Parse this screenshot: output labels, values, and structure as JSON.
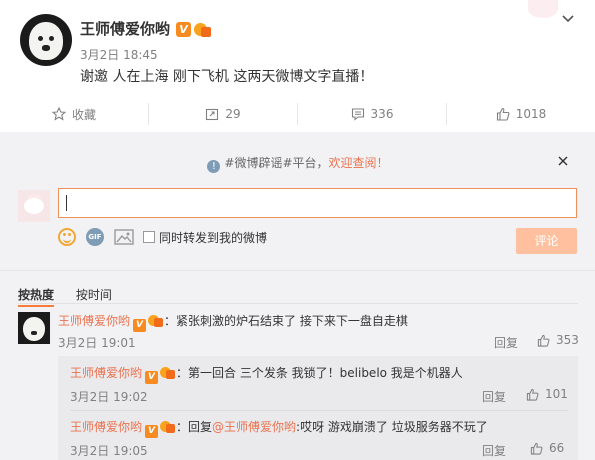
{
  "post": {
    "author": "王师傅爱你哟",
    "verified_badge": "V",
    "time": "3月2日 18:45",
    "text": "谢邀 人在上海 刚下飞机 这两天微博文字直播！",
    "actions": [
      {
        "label": "收藏",
        "icon": "star-icon"
      },
      {
        "label": "29",
        "icon": "share-icon"
      },
      {
        "label": "336",
        "icon": "comment-icon"
      },
      {
        "label": "1018",
        "icon": "like-icon"
      }
    ]
  },
  "notice": {
    "prefix": "#微博辟谣#平台，",
    "link": "欢迎查阅！"
  },
  "composer": {
    "input_value": "",
    "repost_label": "同时转发到我的微博",
    "submit_label": "评论"
  },
  "sort": {
    "hot": "按热度",
    "time": "按时间"
  },
  "comments": [
    {
      "name": "王师傅爱你哟",
      "badge": "V",
      "text": "：紧张刺激的炉石结束了 接下来下一盘自走棋",
      "time": "3月2日 19:01",
      "reply": "回复",
      "likes": "353"
    }
  ],
  "replies": [
    {
      "name": "王师傅爱你哟",
      "badge": "V",
      "text": "：第一回合 三个发条 我锁了！belibelo 我是个机器人",
      "time": "3月2日 19:02",
      "reply": "回复",
      "likes": "101"
    },
    {
      "name": "王师傅爱你哟",
      "badge": "V",
      "text_prefix": "：回复",
      "mention": "@王师傅爱你哟",
      "text": ":哎呀 游戏崩溃了 垃圾服务器不玩了",
      "time": "3月2日 19:05",
      "reply": "回复",
      "likes": "66"
    }
  ],
  "colors": {
    "accent": "#eb7350",
    "badge": "#f78b1f",
    "submit_disabled": "#ffc09f",
    "panel": "#f2f2f5"
  }
}
